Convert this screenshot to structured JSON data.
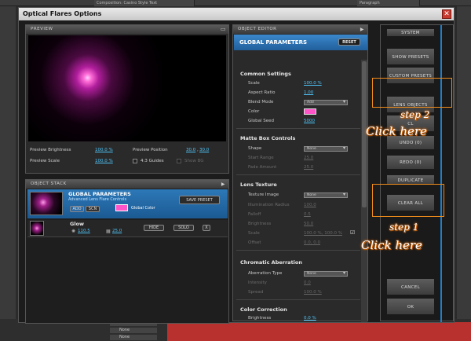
{
  "host": {
    "tab_composition": "Composition: Casino Style Text",
    "tab_paragraph": "Paragraph",
    "layers": [
      "None",
      "None",
      "None",
      "None"
    ]
  },
  "dialog": {
    "title": "Optical Flares Options",
    "close": "✕"
  },
  "preview": {
    "header": "PREVIEW",
    "brightness_label": "Preview Brightness",
    "brightness_value": "100.0 %",
    "position_label": "Preview Position",
    "position_x": "30.0",
    "position_y": "30.0",
    "scale_label": "Preview Scale",
    "scale_value": "100.0 %",
    "guides_label": "4:3 Guides",
    "showbg_label": "Show BG"
  },
  "stack": {
    "header": "OBJECT STACK",
    "gp_title": "GLOBAL PARAMETERS",
    "gp_subtitle": "Advanced Lens Flare Controls",
    "add": "ADD",
    "scn": "SCN",
    "global_color": "Global Color",
    "save_preset": "SAVE PRESET",
    "glow_name": "Glow",
    "glow_val1": "110.5",
    "glow_val2": "25.0",
    "hide": "HIDE",
    "solo": "SOLO",
    "x": "X"
  },
  "editor": {
    "header": "OBJECT EDITOR",
    "title": "GLOBAL PARAMETERS",
    "reset": "RESET",
    "sec_common": "Common Settings",
    "scale_label": "Scale",
    "scale_value": "100.0 %",
    "aspect_label": "Aspect Ratio",
    "aspect_value": "1.00",
    "blend_label": "Blend Mode",
    "blend_value": "Add",
    "color_label": "Color",
    "seed_label": "Global Seed",
    "seed_value": "5000",
    "sec_matte": "Matte Box Controls",
    "shape_label": "Shape",
    "shape_value": "None",
    "start_label": "Start Range",
    "start_value": "25.0",
    "fade_label": "Fade Amount",
    "fade_value": "25.0",
    "sec_texture": "Lens Texture",
    "teximg_label": "Texture Image",
    "teximg_value": "None",
    "illum_label": "Illumination Radius",
    "illum_value": "100.0",
    "falloff_label": "Falloff",
    "falloff_value": "0.5",
    "bright_label": "Brightness",
    "bright_value": "50.0",
    "tscale_label": "Scale",
    "tscale_value": "100.0 %, 100.0 %",
    "offset_label": "Offset",
    "offset_value": "0.0, 0.0",
    "sec_chrom": "Chromatic Aberration",
    "abtype_label": "Aberration Type",
    "abtype_value": "None",
    "intensity_label": "Intensity",
    "intensity_value": "0.0",
    "spread_label": "Spread",
    "spread_value": "100.0 %",
    "sec_color": "Color Correction",
    "cbright_label": "Brightness",
    "cbright_value": "0.0 %"
  },
  "system": {
    "header": "SYSTEM",
    "show_presets": "SHOW PRESETS",
    "custom_presets": "CUSTOM PRESETS",
    "lens_objects": "LENS OBJECTS",
    "clear_prefix": "CL",
    "undo": "UNDO (0)",
    "redo": "REDO (0)",
    "duplicate": "DUPLICATE",
    "clear_all": "CLEAR ALL",
    "cancel": "CANCEL",
    "ok": "OK"
  },
  "annotations": {
    "step2": "step 2",
    "click2": "Click here",
    "step1": "step 1",
    "click1": "Click here"
  },
  "colors": {
    "accent_blue": "#2a7bc0",
    "swatch_pink": "#ff55c8",
    "highlight_orange": "#f08c1c"
  }
}
